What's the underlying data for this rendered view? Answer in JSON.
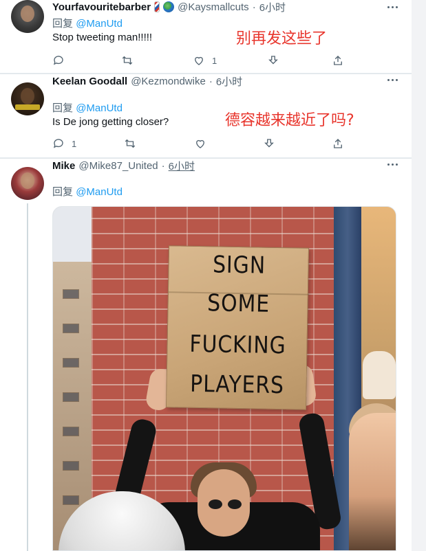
{
  "tweets": [
    {
      "display_name": "Yourfavouritebarber",
      "handle": "@Kaysmallcuts",
      "separator": "·",
      "time": "6小时",
      "reply_prefix": "回复",
      "reply_to": "@ManUtd",
      "text": "Stop tweeting man!!!!!",
      "annotation": "别再发这些了",
      "likes": "1",
      "replies": ""
    },
    {
      "display_name": "Keelan Goodall",
      "handle": "@Kezmondwike",
      "separator": "·",
      "time": "6小时",
      "reply_prefix": "回复",
      "reply_to": "@ManUtd",
      "text": "Is De jong getting closer?",
      "annotation": "德容越来越近了吗?",
      "likes": "",
      "replies": "1"
    },
    {
      "display_name": "Mike",
      "handle": "@Mike87_United",
      "separator": "·",
      "time": "6小时",
      "reply_prefix": "回复",
      "reply_to": "@ManUtd",
      "image_sign_lines": [
        "SIGN",
        "SOME",
        "FUCKING",
        "PLAYERS"
      ]
    }
  ],
  "icons": {
    "reply": "speech-bubble-icon",
    "retweet": "retweet-arrows-icon",
    "like": "heart-icon",
    "download": "download-arrow-icon",
    "share": "share-upload-icon",
    "more": "three-dots-icon"
  },
  "colors": {
    "mention": "#1d9bf0",
    "muted_text": "#536471",
    "annotation": "#e8352c"
  }
}
